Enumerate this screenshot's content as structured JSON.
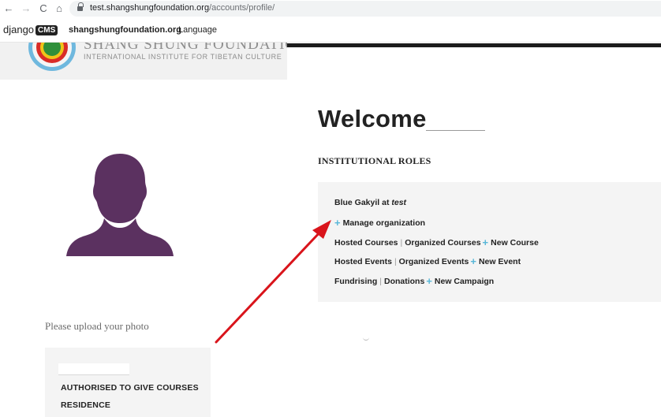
{
  "browser": {
    "back_icon": "←",
    "forward_icon": "→",
    "reload_icon": "C",
    "home_icon": "⌂",
    "url_domain": "test.shangshungfoundation.org",
    "url_path": "/accounts/profile/"
  },
  "cms_toolbar": {
    "logo_text": "django",
    "logo_badge": "CMS",
    "site_name": "shangshungfoundation.org",
    "language_menu": "Language"
  },
  "site_header": {
    "title": "SHANG SHUNG FOUNDATION",
    "subtitle": "INTERNATIONAL INSTITUTE FOR TIBETAN CULTURE"
  },
  "profile": {
    "upload_prompt": "Please upload your photo",
    "avatar_color": "#5b3160"
  },
  "left_card": {
    "line1": "AUTHORISED TO GIVE COURSES",
    "line2": "RESIDENCE"
  },
  "main": {
    "welcome": "Welcome",
    "roles_heading": "INSTITUTIONAL ROLES",
    "role": {
      "name": "Blue Gakyil at",
      "org": "test"
    },
    "manage": "Manage organization",
    "courses": {
      "hosted": "Hosted Courses",
      "organized": "Organized Courses",
      "new": "New Course"
    },
    "events": {
      "hosted": "Hosted Events",
      "organized": "Organized Events",
      "new": "New Event"
    },
    "fundraising": {
      "fundraising": "Fundrising",
      "donations": "Donations",
      "new": "New Campaign"
    }
  },
  "colors": {
    "accent_plus": "#58b7d8",
    "arrow": "#d9141b"
  }
}
